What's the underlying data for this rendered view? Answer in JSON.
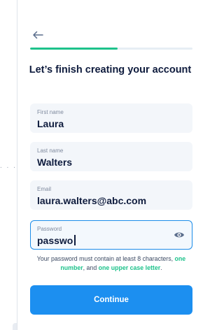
{
  "header": {
    "back_icon": "arrow-left-icon",
    "progress": 0.54
  },
  "title": "Let’s finish creating your account",
  "form": {
    "first_name": {
      "label": "First name",
      "value": "Laura"
    },
    "last_name": {
      "label": "Last name",
      "value": "Walters"
    },
    "email": {
      "label": "Email",
      "value": "laura.walters@abc.com"
    },
    "password": {
      "label": "Password",
      "value": "passwo",
      "reveal_icon": "eye-icon"
    }
  },
  "hint": {
    "prefix": "Your password must contain at least 8 characters,",
    "req_number": "one number",
    "middle": ", and ",
    "req_upper": "one upper case letter",
    "suffix": "."
  },
  "continue_label": "Continue",
  "edge_dots": ". . .",
  "colors": {
    "accent_blue": "#1c8ff0",
    "accent_green": "#1ec28b",
    "text_dark": "#0e1b3d",
    "field_bg": "#f3f6fa"
  }
}
